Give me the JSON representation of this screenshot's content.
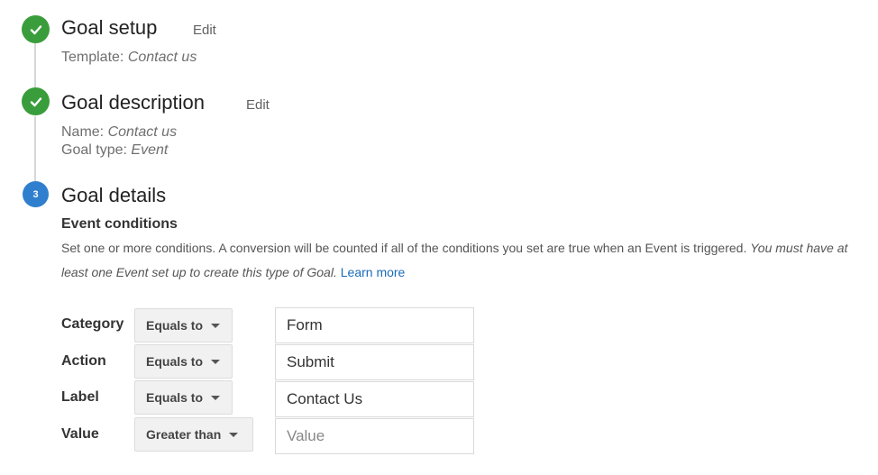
{
  "steps": [
    {
      "status": "complete",
      "icon": "check-icon",
      "title": "Goal setup",
      "edit_label": "Edit",
      "details": [
        {
          "label": "Template:",
          "value": "Contact us"
        }
      ]
    },
    {
      "status": "complete",
      "icon": "check-icon",
      "title": "Goal description",
      "edit_label": "Edit",
      "details": [
        {
          "label": "Name:",
          "value": "Contact us"
        },
        {
          "label": "Goal type:",
          "value": "Event"
        }
      ]
    },
    {
      "status": "current",
      "number": "3",
      "title": "Goal details"
    }
  ],
  "event_conditions": {
    "heading": "Event conditions",
    "description": "Set one or more conditions. A conversion will be counted if all of the conditions you set are true when an Event is triggered.",
    "description_italic": "You must have at least one Event set up to create this type of Goal.",
    "learn_more": "Learn more",
    "conditions": [
      {
        "label": "Category",
        "operator": "Equals to",
        "value": "Form",
        "placeholder": ""
      },
      {
        "label": "Action",
        "operator": "Equals to",
        "value": "Submit",
        "placeholder": ""
      },
      {
        "label": "Label",
        "operator": "Equals to",
        "value": "Contact Us",
        "placeholder": ""
      },
      {
        "label": "Value",
        "operator": "Greater than",
        "value": "",
        "placeholder": "Value"
      }
    ]
  },
  "colors": {
    "complete": "#3a9d3c",
    "current": "#2f7fce",
    "link": "#1a6bb8"
  }
}
